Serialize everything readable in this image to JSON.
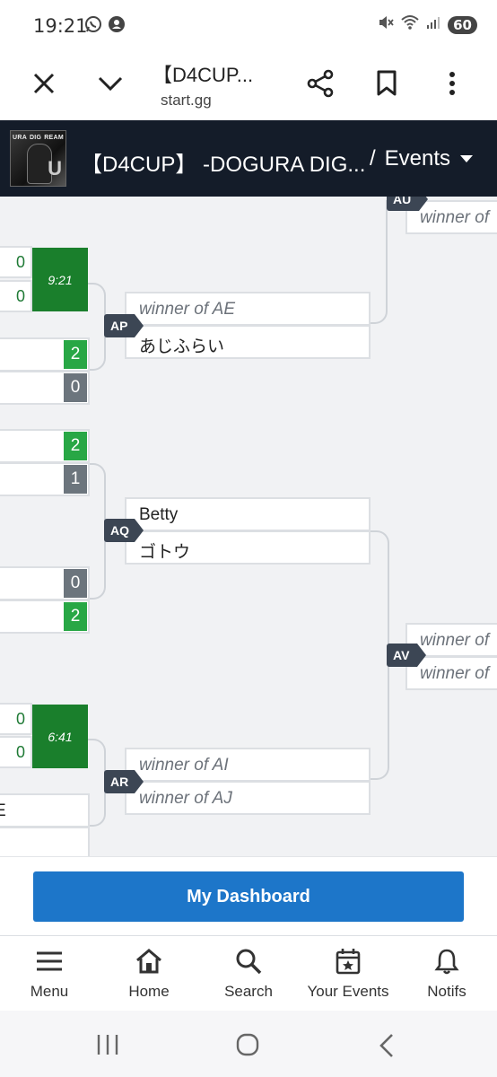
{
  "status_bar": {
    "time": "19:21",
    "battery": "60"
  },
  "browser": {
    "title": "【D4CUP...",
    "url": "start.gg"
  },
  "header": {
    "title": "【D4CUP】 -DOGURA DIG...",
    "separator": "/",
    "events_label": "Events"
  },
  "logo_text": [
    "URA",
    "DIG",
    "REAM"
  ],
  "bracket": {
    "au": {
      "label": "AU",
      "slot_top": "winner of"
    },
    "ap": {
      "label": "AP",
      "top": "winner of AE",
      "bottom": "あじふらい"
    },
    "aq": {
      "label": "AQ",
      "top": "Betty",
      "bottom": "ゴトウ"
    },
    "av": {
      "label": "AV",
      "top": "winner of",
      "bottom": "winner of"
    },
    "ar": {
      "label": "AR",
      "top": "winner of AI",
      "bottom": "winner of AJ"
    },
    "left_matches": {
      "m1": {
        "score_top": "0",
        "score_bottom": "0",
        "time": "9:21"
      },
      "m2": {
        "score_top": "2",
        "score_bottom": "0"
      },
      "m3": {
        "score_top": "2",
        "score_bottom": "1"
      },
      "m4": {
        "score_top": "0",
        "score_bottom": "2"
      },
      "m5": {
        "score_top": "0",
        "score_bottom": "0",
        "time": "6:41"
      },
      "m6": {
        "partial_name": "E"
      }
    }
  },
  "dashboard_button": "My Dashboard",
  "bottom_nav": [
    {
      "label": "Menu",
      "icon": "menu-icon"
    },
    {
      "label": "Home",
      "icon": "home-icon"
    },
    {
      "label": "Search",
      "icon": "search-icon"
    },
    {
      "label": "Your Events",
      "icon": "calendar-star-icon"
    },
    {
      "label": "Notifs",
      "icon": "bell-icon"
    }
  ],
  "colors": {
    "header_bg": "#141c29",
    "win": "#28a745",
    "lose": "#6c757d",
    "live": "#1a7f2c",
    "primary": "#1d76c9",
    "badge": "#3c4654"
  }
}
